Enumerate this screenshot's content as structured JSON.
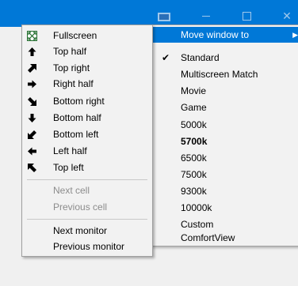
{
  "left_menu": {
    "items": [
      {
        "label": "Fullscreen",
        "icon": "fullscreen-icon",
        "enabled": true
      },
      {
        "label": "Top half",
        "icon": "arrow-up-icon",
        "enabled": true
      },
      {
        "label": "Top right",
        "icon": "arrow-up-right-icon",
        "enabled": true
      },
      {
        "label": "Right half",
        "icon": "arrow-right-icon",
        "enabled": true
      },
      {
        "label": "Bottom right",
        "icon": "arrow-down-right-icon",
        "enabled": true
      },
      {
        "label": "Bottom half",
        "icon": "arrow-down-icon",
        "enabled": true
      },
      {
        "label": "Bottom left",
        "icon": "arrow-down-left-icon",
        "enabled": true
      },
      {
        "label": "Left half",
        "icon": "arrow-left-icon",
        "enabled": true
      },
      {
        "label": "Top left",
        "icon": "arrow-up-left-icon",
        "enabled": true
      },
      {
        "label": "Next cell",
        "enabled": false
      },
      {
        "label": "Previous cell",
        "enabled": false
      },
      {
        "label": "Next monitor",
        "enabled": true
      },
      {
        "label": "Previous monitor",
        "enabled": true
      }
    ]
  },
  "right_menu": {
    "items": [
      {
        "label": "Move window to",
        "highlighted": true,
        "submenu": true
      },
      {
        "label": "Standard",
        "checked": true
      },
      {
        "label": "Multiscreen Match"
      },
      {
        "label": "Movie"
      },
      {
        "label": "Game"
      },
      {
        "label": "5000k"
      },
      {
        "label": "5700k",
        "bold": true
      },
      {
        "label": "6500k"
      },
      {
        "label": "7500k"
      },
      {
        "label": "9300k"
      },
      {
        "label": "10000k"
      },
      {
        "label": "Custom"
      },
      {
        "label": "ComfortView"
      }
    ],
    "check_glyph": "✔",
    "submenu_glyph": "▶"
  },
  "colors": {
    "titlebar": "#0078d7",
    "highlight": "#0078d7",
    "menu_bg": "#f2f2f2",
    "disabled_text": "#8c8c8c"
  }
}
